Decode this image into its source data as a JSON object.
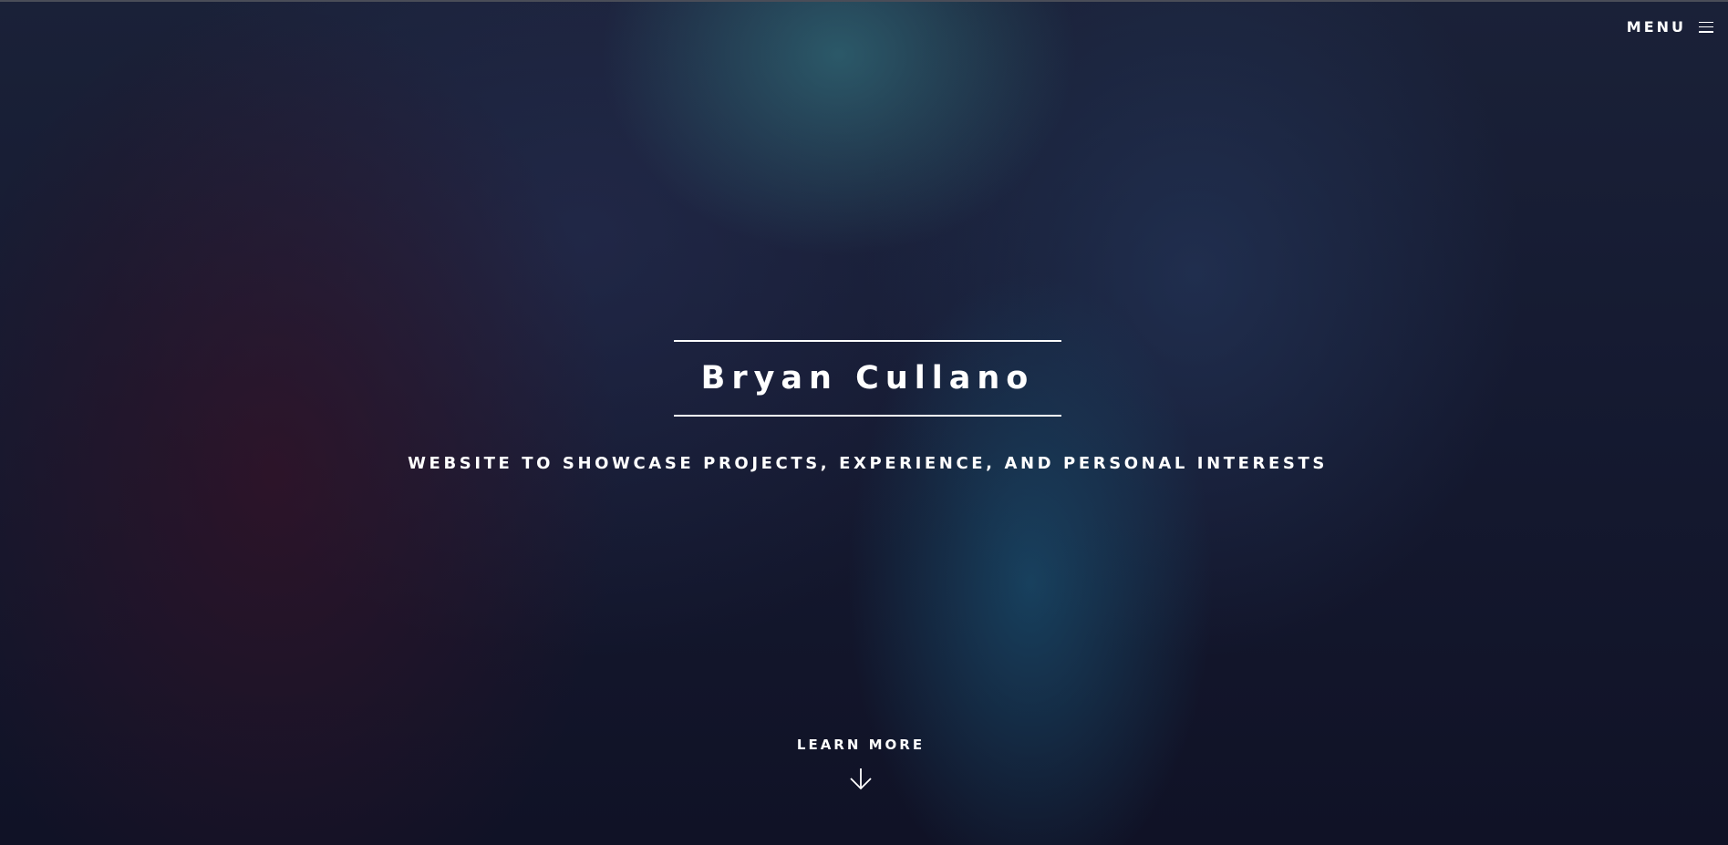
{
  "header": {
    "menu_label": "MENU",
    "menu_icon": "hamburger-icon"
  },
  "hero": {
    "title": "Bryan Cullano",
    "subtitle": "WEBSITE TO SHOWCASE PROJECTS, EXPERIENCE, AND PERSONAL INTERESTS",
    "learn_more_label": "LEARN MORE",
    "learn_more_icon": "arrow-down-icon"
  },
  "colors": {
    "text": "#ffffff",
    "background_dark": "#121326",
    "background_teal": "#2e6270",
    "background_maroon": "#341226"
  }
}
